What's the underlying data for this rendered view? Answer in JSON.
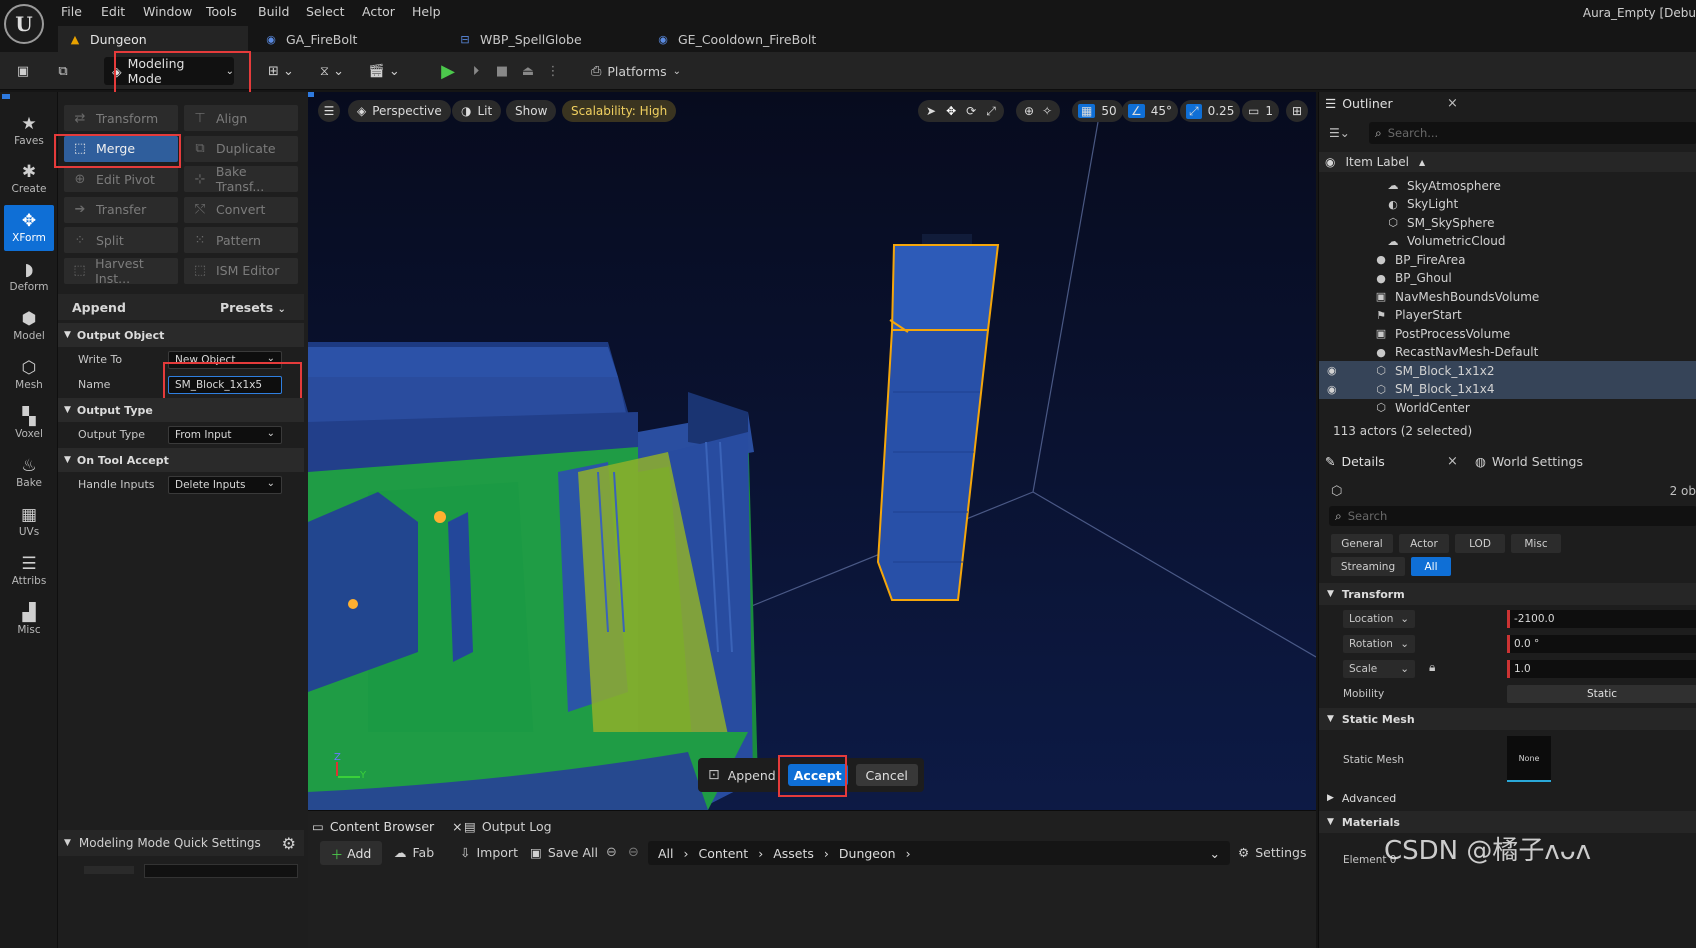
{
  "app": {
    "logo_glyph": "U",
    "project_name": "Aura_Empty [Debu"
  },
  "menu": [
    "File",
    "Edit",
    "Window",
    "Tools",
    "Build",
    "Select",
    "Actor",
    "Help"
  ],
  "tabs": [
    {
      "label": "Dungeon",
      "icon": "level-icon"
    },
    {
      "label": "GA_FireBolt",
      "icon": "blueprint-icon"
    },
    {
      "label": "WBP_SpellGlobe",
      "icon": "widget-icon"
    },
    {
      "label": "GE_Cooldown_FireBolt",
      "icon": "blueprint-icon"
    }
  ],
  "toolbar": {
    "mode_label": "Modeling Mode",
    "platforms_label": "Platforms"
  },
  "rail": [
    {
      "label": "Faves",
      "glyph": "★"
    },
    {
      "label": "Create",
      "glyph": "✱"
    },
    {
      "label": "XForm",
      "glyph": "✥"
    },
    {
      "label": "Deform",
      "glyph": "◗"
    },
    {
      "label": "Model",
      "glyph": "⬢"
    },
    {
      "label": "Mesh",
      "glyph": "⬡"
    },
    {
      "label": "Voxel",
      "glyph": "▚"
    },
    {
      "label": "Bake",
      "glyph": "♨"
    },
    {
      "label": "UVs",
      "glyph": "▦"
    },
    {
      "label": "Attribs",
      "glyph": "☰"
    },
    {
      "label": "Misc",
      "glyph": "▟"
    }
  ],
  "tools": [
    [
      "Transform",
      "Align"
    ],
    [
      "Merge",
      "Duplicate"
    ],
    [
      "Edit Pivot",
      "Bake Transf..."
    ],
    [
      "Transfer",
      "Convert"
    ],
    [
      "Split",
      "Pattern"
    ],
    [
      "Harvest Inst...",
      "ISM Editor"
    ]
  ],
  "panel": {
    "append_label": "Append",
    "presets_label": "Presets",
    "output_object": "Output Object",
    "write_to_label": "Write To",
    "write_to_value": "New Object",
    "name_label": "Name",
    "name_value": "SM_Block_1x1x5",
    "output_type_section": "Output Type",
    "output_type_label": "Output Type",
    "output_type_value": "From Input",
    "on_accept_section": "On Tool Accept",
    "handle_inputs_label": "Handle Inputs",
    "handle_inputs_value": "Delete Inputs",
    "quick_settings": "Modeling Mode Quick Settings"
  },
  "viewport": {
    "perspective": "Perspective",
    "lit": "Lit",
    "show": "Show",
    "scalability": "Scalability: High",
    "grid": "50",
    "angle": "45°",
    "scale": "0.25",
    "camera": "1",
    "append": "Append",
    "accept": "Accept",
    "cancel": "Cancel",
    "axis_z": "Z",
    "axis_y": "Y"
  },
  "bottom": {
    "content_browser": "Content Browser",
    "output_log": "Output Log",
    "add": "Add",
    "fab": "Fab",
    "import": "Import",
    "save_all": "Save All",
    "path": [
      "All",
      "Content",
      "Assets",
      "Dungeon"
    ],
    "settings": "Settings"
  },
  "outliner": {
    "title": "Outliner",
    "search_placeholder": "Search...",
    "column": "Item Label",
    "items": [
      {
        "label": "SkyAtmosphere",
        "indent": 2,
        "icon": "☁"
      },
      {
        "label": "SkyLight",
        "indent": 2,
        "icon": "◐"
      },
      {
        "label": "SM_SkySphere",
        "indent": 2,
        "icon": "⬡"
      },
      {
        "label": "VolumetricCloud",
        "indent": 2,
        "icon": "☁"
      },
      {
        "label": "BP_FireArea",
        "indent": 1,
        "icon": "●"
      },
      {
        "label": "BP_Ghoul",
        "indent": 1,
        "icon": "●"
      },
      {
        "label": "NavMeshBoundsVolume",
        "indent": 1,
        "icon": "▣"
      },
      {
        "label": "PlayerStart",
        "indent": 1,
        "icon": "⚑"
      },
      {
        "label": "PostProcessVolume",
        "indent": 1,
        "icon": "▣"
      },
      {
        "label": "RecastNavMesh-Default",
        "indent": 1,
        "icon": "●"
      },
      {
        "label": "SM_Block_1x1x2",
        "indent": 1,
        "icon": "⬡",
        "selected": true
      },
      {
        "label": "SM_Block_1x1x4",
        "indent": 1,
        "icon": "⬡",
        "selected": true
      },
      {
        "label": "WorldCenter",
        "indent": 1,
        "icon": "⬡"
      }
    ],
    "count": "113 actors (2 selected)"
  },
  "details": {
    "title": "Details",
    "world_settings": "World Settings",
    "obj_count": "2 ob",
    "search_placeholder": "Search",
    "chips": [
      "General",
      "Actor",
      "LOD",
      "Misc"
    ],
    "chips2": [
      "Streaming",
      "All"
    ],
    "transform": "Transform",
    "location": "Location",
    "location_value": "-2100.0",
    "rotation": "Rotation",
    "rotation_value": "0.0 °",
    "scale": "Scale",
    "scale_value": "1.0",
    "mobility": "Mobility",
    "mobility_value": "Static",
    "static_mesh_section": "Static Mesh",
    "static_mesh_label": "Static Mesh",
    "static_mesh_value": "None",
    "advanced": "Advanced",
    "materials": "Materials",
    "element0": "Element 0"
  },
  "watermark": "CSDN @橘子ʌᴗʌ",
  "colors": {
    "accent": "#0f6fd6",
    "selection_outline": "#f4a60b",
    "highlight_box": "#e53b3b",
    "floor": "#1fa34a",
    "wall": "#2b4f99"
  }
}
